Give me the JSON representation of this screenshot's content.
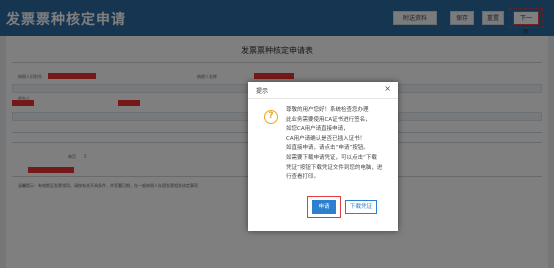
{
  "header": {
    "title": "发票票种核定申请",
    "buttons": {
      "help": "附送资料",
      "save": "保存",
      "reset": "重置",
      "next": "下一步"
    }
  },
  "form": {
    "title": "发票票种核定申请表",
    "taxpayer_id_label": "纳税人识别号",
    "taxpayer_name_label": "纳税人名称",
    "agent_label": "经办人",
    "page_size_label": "每页",
    "page_size_value": "5",
    "footer_note": "温馨提示：有效期至发票领用，请按有关开具条件，并签署日期，在一般纳税人办理发票相关核定事项"
  },
  "dialog": {
    "title": "提示",
    "close_symbol": "×",
    "message_lines": [
      "尊敬的用户您好！系统检查您办理",
      "此业务需要使用CA证书进行签名，",
      "如您CA用户请直接申请，",
      "CA用户请确认是否已插入证书！",
      "如直接申请，请点击“申请”按钮。",
      "如需要下载申请凭证，可以点击“下载",
      "凭证”按钮下载凭证文件到您的电脑，进",
      "行查看打印。"
    ],
    "apply_label": "申请",
    "download_label": "下载凭证"
  },
  "colors": {
    "header_bg": "#2d6aa3",
    "primary": "#2d7fd0",
    "highlight": "#e23b3b",
    "warning": "#f2a51a"
  }
}
